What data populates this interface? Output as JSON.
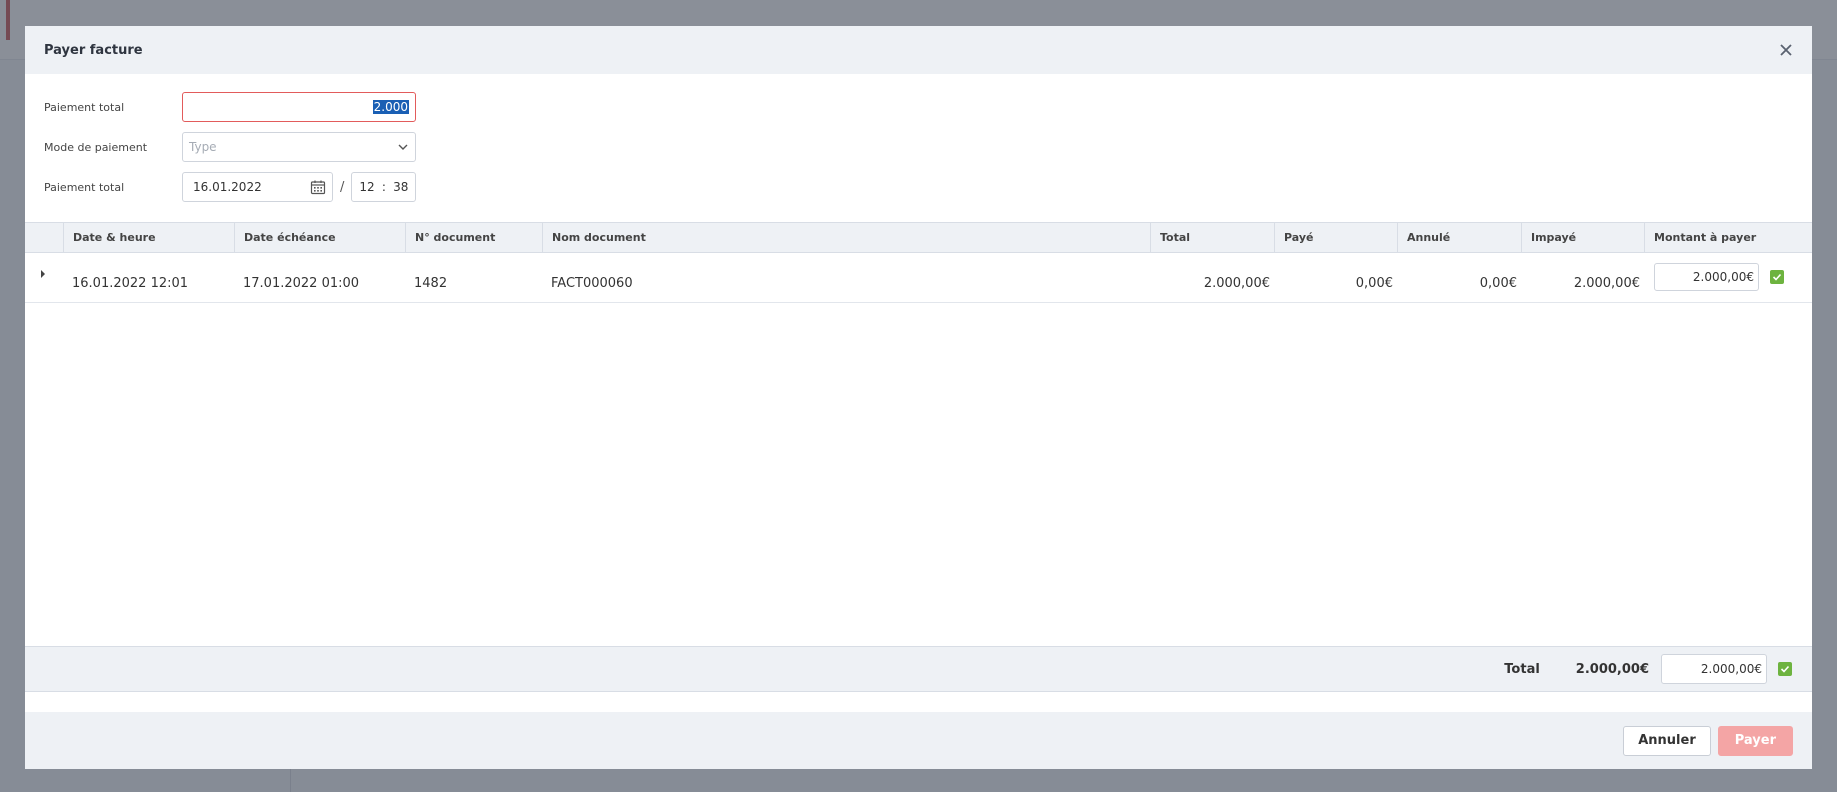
{
  "modal": {
    "title": "Payer facture"
  },
  "form": {
    "total_label": "Paiement total",
    "total_value": "2.000",
    "mode_label": "Mode de paiement",
    "mode_placeholder": "Type",
    "date_label": "Paiement total",
    "date_value": "16.01.2022",
    "separator": "/",
    "time_hour": "12",
    "time_colon": ":",
    "time_minute": "38"
  },
  "table": {
    "headers": [
      "Date & heure",
      "Date échéance",
      "N° document",
      "Nom document",
      "Total",
      "Payé",
      "Annulé",
      "Impayé",
      "Montant à payer"
    ],
    "rows": [
      {
        "date_heure": "16.01.2022 12:01",
        "date_echeance": "17.01.2022 01:00",
        "n_document": "1482",
        "nom_document": "FACT000060",
        "total": "2.000,00€",
        "paye": "0,00€",
        "annule": "0,00€",
        "impaye": "2.000,00€",
        "montant": "2.000,00€"
      }
    ]
  },
  "footer_total": {
    "label": "Total",
    "value": "2.000,00€",
    "input_value": "2.000,00€"
  },
  "buttons": {
    "cancel": "Annuler",
    "pay": "Payer"
  },
  "colors": {
    "accent_green": "#6db33f",
    "pay_disabled": "#f4a5a5",
    "error_border": "#e25b5b"
  }
}
